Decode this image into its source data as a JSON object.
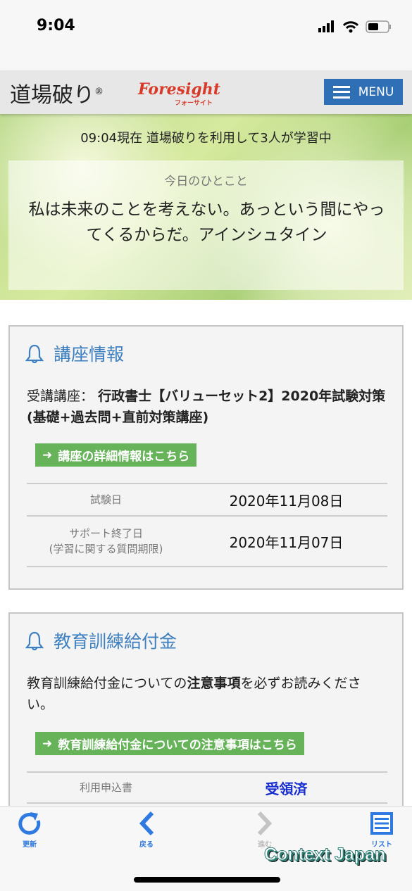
{
  "status_bar": {
    "time": "9:04"
  },
  "header": {
    "logo_main": "道場破り",
    "logo_mark": "®",
    "logo_brand": "Foresight",
    "logo_brand_sub": "フォーサイト",
    "menu_label": "MENU",
    "accent": "#2f6fb5"
  },
  "hero": {
    "online_text": "09:04現在 道場破りを利用して3人が学習中",
    "quote_title": "今日のひとこと",
    "quote_text": "私は未来のことを考えない。あっという間にやってくるからだ。アインシュタイン"
  },
  "course_card": {
    "title": "講座情報",
    "course_label": "受講講座：",
    "course_name": "行政書士【バリューセット2】2020年試験対策(基礎+過去問+直前対策講座)",
    "detail_link": "講座の詳細情報はこちら",
    "rows": [
      {
        "label": "試験日",
        "label2": "",
        "value": "2020年11月08日"
      },
      {
        "label": "サポート終了日",
        "label2": "(学習に関する質問期限)",
        "value": "2020年11月07日"
      }
    ]
  },
  "grant_card": {
    "title": "教育訓練給付金",
    "notice_pre": "教育訓練給付金についての",
    "notice_bold": "注意事項",
    "notice_post": "を必ずお読みください。",
    "link": "教育訓練給付金についての注意事項はこちら",
    "rows": [
      {
        "label": "利用申込書",
        "value": "受領済",
        "value_color": "#1a2fd0"
      }
    ]
  },
  "bottom_nav": {
    "items": [
      {
        "label": "更新",
        "icon": "refresh-icon"
      },
      {
        "label": "戻る",
        "icon": "chevron-left-icon"
      },
      {
        "label": "進む",
        "icon": "chevron-right-icon",
        "disabled": true
      },
      {
        "label": "リスト",
        "icon": "list-icon"
      }
    ]
  },
  "watermark": "Context Japan"
}
